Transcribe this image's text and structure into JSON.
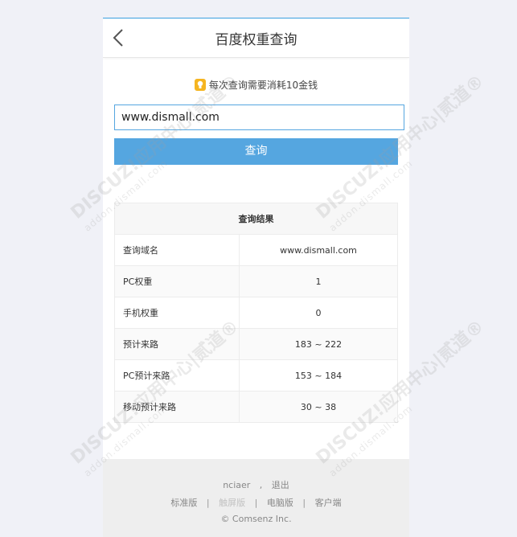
{
  "header": {
    "title": "百度权重查询"
  },
  "notice": {
    "text": "每次查询需要消耗10金钱"
  },
  "search": {
    "value": "www.dismall.com",
    "button_label": "查询"
  },
  "results": {
    "header": "查询结果",
    "rows": [
      {
        "label": "查询域名",
        "value": "www.dismall.com"
      },
      {
        "label": "PC权重",
        "value": "1"
      },
      {
        "label": "手机权重",
        "value": "0"
      },
      {
        "label": "预计来路",
        "value": "183 ~ 222"
      },
      {
        "label": "PC预计来路",
        "value": "153 ~ 184"
      },
      {
        "label": "移动预计来路",
        "value": "30 ~ 38"
      }
    ]
  },
  "footer": {
    "username": "nciaer",
    "comma": ",",
    "logout": "退出",
    "links": [
      "标准版",
      "触屏版",
      "电脑版",
      "客户端"
    ],
    "separator": "|",
    "copyright": "© Comsenz Inc."
  },
  "watermark": {
    "brand": "DISCUZ!应用中心|贰道®",
    "site": "addon.dismall.com"
  },
  "colors": {
    "accent": "#55a6e0",
    "background": "#f0f1f7",
    "footer_bg": "#eeeeee"
  },
  "icons": [
    "chevron-left-icon",
    "lightbulb-icon"
  ]
}
